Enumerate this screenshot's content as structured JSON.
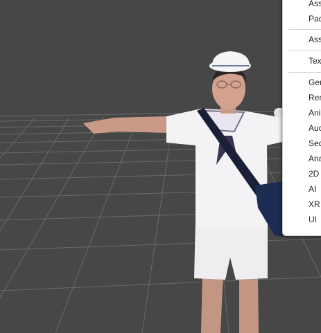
{
  "scene": {
    "background_color": "#474747",
    "grid_color": "#6b6b6b",
    "character": {
      "description_icon": "character-model-icon",
      "outfit_color": "#f2f2f4",
      "skin_color": "#c99a86",
      "bag_color": "#1d2c52"
    }
  },
  "context_menu": {
    "items": [
      {
        "label": "Ass"
      },
      {
        "label": "Pac"
      },
      {
        "label": "Ass"
      },
      {
        "label": "Tex"
      },
      {
        "label": "Ger"
      },
      {
        "label": "Ren"
      },
      {
        "label": "Ani"
      },
      {
        "label": "Auc"
      },
      {
        "label": "Seq"
      },
      {
        "label": "Ana"
      },
      {
        "label": "2D"
      },
      {
        "label": "AI"
      },
      {
        "label": "XR"
      },
      {
        "label": "UI"
      }
    ]
  }
}
